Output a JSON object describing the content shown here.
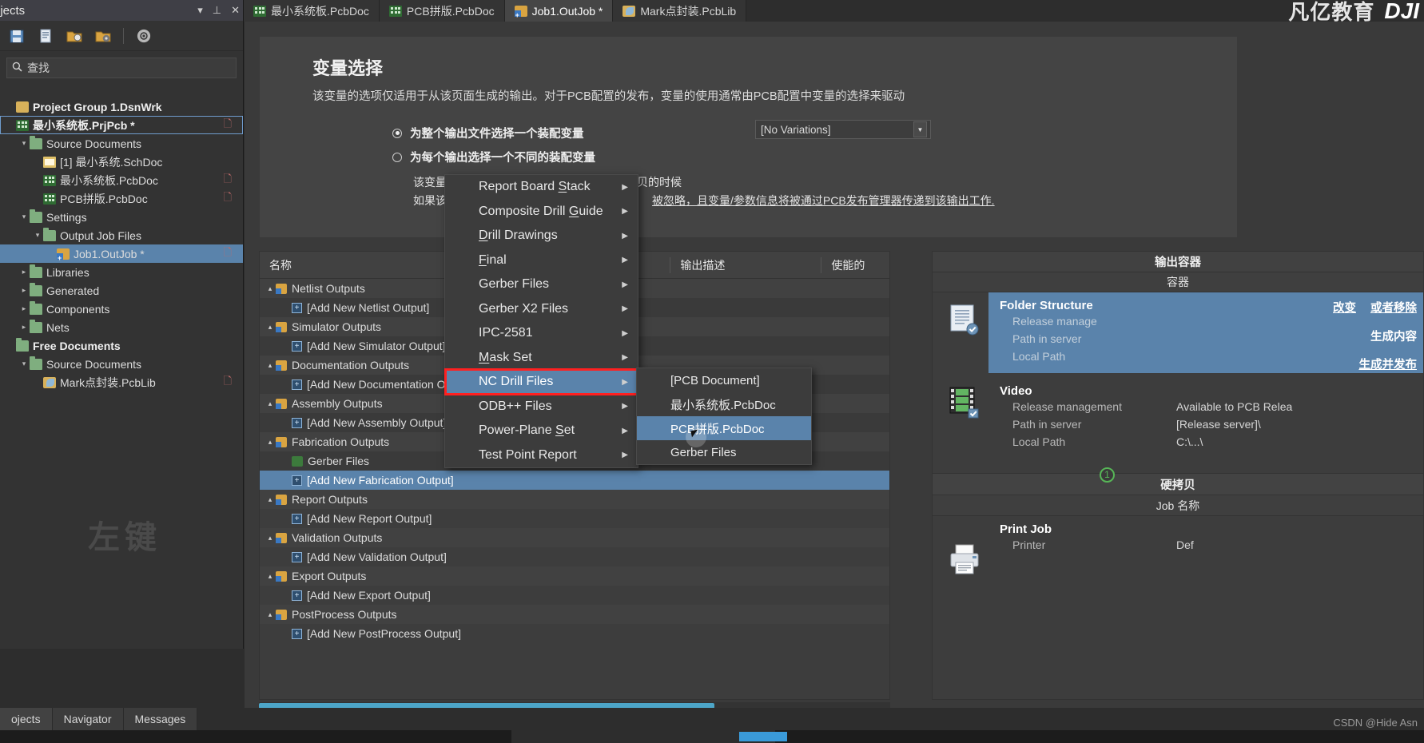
{
  "panel": {
    "title": "ojects",
    "collapse_icon": "chevron-down-icon",
    "pin_icon": "pin-icon",
    "close_icon": "close-icon",
    "search_placeholder": "查找",
    "search_icon": "search-icon",
    "watermark": "左键",
    "toolbar_icons": [
      "save-icon",
      "document-icon",
      "open-folder-icon",
      "folder-options-icon",
      "gear-icon"
    ]
  },
  "tree": [
    {
      "label": "Project Group 1.DsnWrk",
      "icon": "folder-y",
      "depth": 0,
      "arrow": "",
      "bold": true,
      "selected": false,
      "mark": ""
    },
    {
      "label": "最小系统板.PrjPcb *",
      "icon": "pcb",
      "depth": 0,
      "arrow": "",
      "bold": true,
      "selected": false,
      "boxed": true,
      "mark": "D"
    },
    {
      "label": "Source Documents",
      "icon": "folder",
      "depth": 1,
      "arrow": "▾",
      "bold": false,
      "selected": false,
      "mark": ""
    },
    {
      "label": "[1] 最小系统.SchDoc",
      "icon": "sch",
      "depth": 2,
      "arrow": "",
      "bold": false,
      "selected": false,
      "mark": ""
    },
    {
      "label": "最小系统板.PcbDoc",
      "icon": "pcb",
      "depth": 2,
      "arrow": "",
      "bold": false,
      "selected": false,
      "mark": "D"
    },
    {
      "label": "PCB拼版.PcbDoc",
      "icon": "pcb",
      "depth": 2,
      "arrow": "",
      "bold": false,
      "selected": false,
      "mark": "D"
    },
    {
      "label": "Settings",
      "icon": "folder",
      "depth": 1,
      "arrow": "▾",
      "bold": false,
      "selected": false,
      "mark": ""
    },
    {
      "label": "Output Job Files",
      "icon": "folder",
      "depth": 2,
      "arrow": "▾",
      "bold": false,
      "selected": false,
      "mark": ""
    },
    {
      "label": "Job1.OutJob *",
      "icon": "outjob",
      "depth": 3,
      "arrow": "",
      "bold": false,
      "selected": true,
      "mark": "D"
    },
    {
      "label": "Libraries",
      "icon": "folder",
      "depth": 1,
      "arrow": "▸",
      "bold": false,
      "selected": false,
      "mark": ""
    },
    {
      "label": "Generated",
      "icon": "folder",
      "depth": 1,
      "arrow": "▸",
      "bold": false,
      "selected": false,
      "mark": ""
    },
    {
      "label": "Components",
      "icon": "folder",
      "depth": 1,
      "arrow": "▸",
      "bold": false,
      "selected": false,
      "mark": ""
    },
    {
      "label": "Nets",
      "icon": "folder",
      "depth": 1,
      "arrow": "▸",
      "bold": false,
      "selected": false,
      "mark": ""
    },
    {
      "label": "Free Documents",
      "icon": "folder",
      "depth": 0,
      "arrow": "",
      "bold": true,
      "selected": false,
      "mark": ""
    },
    {
      "label": "Source Documents",
      "icon": "folder",
      "depth": 1,
      "arrow": "▾",
      "bold": false,
      "selected": false,
      "mark": ""
    },
    {
      "label": "Mark点封装.PcbLib",
      "icon": "pcblib",
      "depth": 2,
      "arrow": "",
      "bold": false,
      "selected": false,
      "mark": "D"
    }
  ],
  "tabs": [
    {
      "label": "最小系统板.PcbDoc",
      "icon": "pcb",
      "active": false
    },
    {
      "label": "PCB拼版.PcbDoc",
      "icon": "pcb",
      "active": false
    },
    {
      "label": "Job1.OutJob *",
      "icon": "outjob",
      "active": true
    },
    {
      "label": "Mark点封装.PcbLib",
      "icon": "pcblib",
      "active": false
    }
  ],
  "logo": {
    "cn": "凡亿教育",
    "brand": "DJI"
  },
  "variant": {
    "title": "变量选择",
    "description": "该变量的选项仅适用于从该页面生成的输出。对于PCB配置的发布，变量的使用通常由PCB配置中变量的选择来驱动",
    "radio1": "为整个输出文件选择一个装配变量",
    "radio2": "为每个输出选择一个不同的装配变量",
    "note1": "该变量将仅被用于生成输出并从这里打印硬拷贝的时候",
    "note2_pre": "如果该输",
    "note2_post": "被忽略，且变量/参数信息将被通过PCB发布管理器传递到该输出工作.",
    "combo_value": "[No Variations]",
    "combo_icon": "chevron-down-icon"
  },
  "grid": {
    "col_name": "名称",
    "col_desc": "输出描述",
    "col_enabled": "使能的",
    "rows": [
      {
        "label": "Netlist Outputs",
        "type": "group",
        "arrow": "▴"
      },
      {
        "label": "[Add New Netlist Output]",
        "type": "add"
      },
      {
        "label": "Simulator Outputs",
        "type": "group",
        "arrow": "▴"
      },
      {
        "label": "[Add New Simulator Output]",
        "type": "add"
      },
      {
        "label": "Documentation Outputs",
        "type": "group",
        "arrow": "▴"
      },
      {
        "label": "[Add New Documentation Output]",
        "type": "add"
      },
      {
        "label": "Assembly Outputs",
        "type": "group",
        "arrow": "▴"
      },
      {
        "label": "[Add New Assembly Output]",
        "type": "add"
      },
      {
        "label": "Fabrication Outputs",
        "type": "group",
        "arrow": "▴"
      },
      {
        "label": "Gerber Files",
        "type": "item"
      },
      {
        "label": "[Add New Fabrication Output]",
        "type": "add",
        "selected": true
      },
      {
        "label": "Report Outputs",
        "type": "group",
        "arrow": "▴"
      },
      {
        "label": "[Add New Report Output]",
        "type": "add"
      },
      {
        "label": "Validation Outputs",
        "type": "group",
        "arrow": "▴"
      },
      {
        "label": "[Add New Validation Output]",
        "type": "add"
      },
      {
        "label": "Export Outputs",
        "type": "group",
        "arrow": "▴"
      },
      {
        "label": "[Add New Export Output]",
        "type": "add"
      },
      {
        "label": "PostProcess Outputs",
        "type": "group",
        "arrow": "▴"
      },
      {
        "label": "[Add New PostProcess Output]",
        "type": "add"
      }
    ]
  },
  "containers": {
    "header": "输出容器",
    "subheader": "容器",
    "change_label": "改变",
    "remove_label": "或者移除",
    "items": [
      {
        "name": "Folder Structure",
        "selected": true,
        "icon": "document-container-icon",
        "rows": [
          {
            "key": "Release manage",
            "value": ""
          },
          {
            "key": "Path in server",
            "value": ""
          },
          {
            "key": "Local Path",
            "value": ""
          }
        ],
        "links": [
          "生成内容",
          "生成并发布"
        ]
      },
      {
        "name": "Video",
        "selected": false,
        "icon": "video-container-icon",
        "rows": [
          {
            "key": "Release management",
            "value": "Available to PCB Relea"
          },
          {
            "key": "Path in server",
            "value": "[Release server]\\"
          },
          {
            "key": "Local Path",
            "value": "C:\\...\\"
          }
        ],
        "links": []
      }
    ],
    "hardcopy_header": "硬拷贝",
    "hardcopy_sub": "Job 名称",
    "print_job": {
      "name": "Print Job",
      "key": "Printer",
      "value": "Def",
      "icon": "printer-icon"
    }
  },
  "context_menu": {
    "items": [
      {
        "label": "Report Board Stack",
        "accel": "S",
        "submenu": true
      },
      {
        "label": "Composite Drill Guide",
        "accel": "G",
        "submenu": true
      },
      {
        "label": "Drill Drawings",
        "accel": "D",
        "submenu": true
      },
      {
        "label": "Final",
        "accel": "F",
        "submenu": true
      },
      {
        "label": "Gerber Files",
        "accel": "",
        "submenu": true
      },
      {
        "label": "Gerber X2 Files",
        "accel": "",
        "submenu": true
      },
      {
        "label": "IPC-2581",
        "accel": "",
        "submenu": true
      },
      {
        "label": "Mask Set",
        "accel": "M",
        "submenu": true
      },
      {
        "label": "NC Drill Files",
        "accel": "",
        "submenu": true,
        "highlighted": true,
        "outlined": true
      },
      {
        "label": "ODB++ Files",
        "accel": "",
        "submenu": true
      },
      {
        "label": "Power-Plane Set",
        "accel": "S",
        "submenu": true
      },
      {
        "label": "Test Point Report",
        "accel": "",
        "submenu": true
      }
    ]
  },
  "submenu": {
    "items": [
      {
        "label": "[PCB Document]",
        "highlighted": false
      },
      {
        "label": "最小系统板.PcbDoc",
        "highlighted": false
      },
      {
        "label": "PCB拼版.PcbDoc",
        "highlighted": true
      },
      {
        "label": "Gerber Files",
        "highlighted": false
      }
    ]
  },
  "badge": "1",
  "statusbar": {
    "tabs": [
      "ojects",
      "Navigator",
      "Messages"
    ]
  },
  "credit": "CSDN @Hide Asn"
}
